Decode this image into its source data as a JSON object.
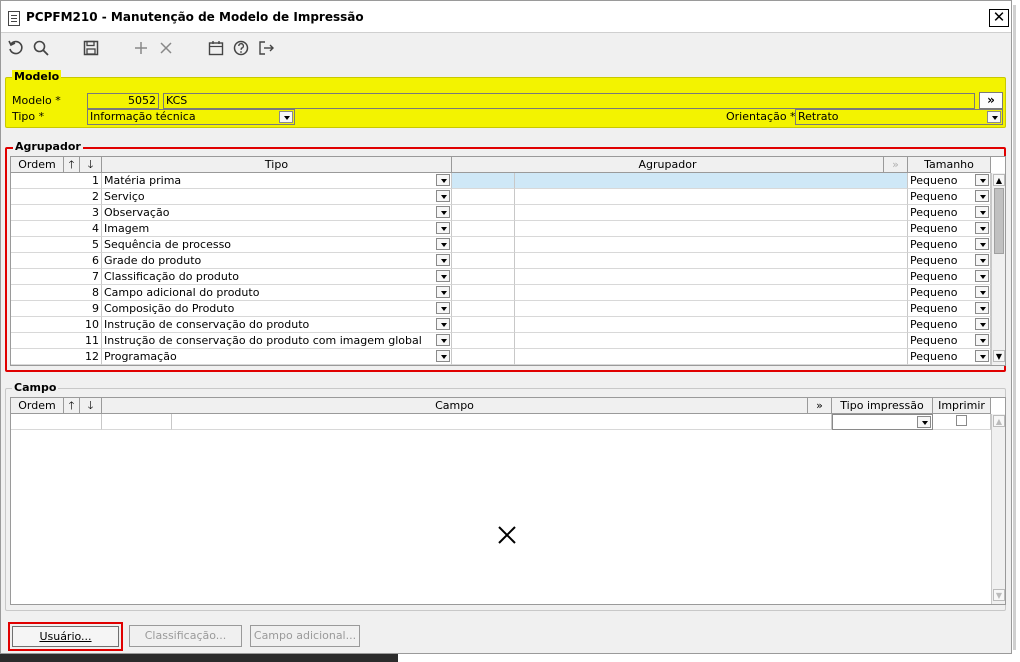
{
  "window": {
    "title": "PCPFM210 - Manutenção de Modelo de Impressão",
    "close_label": "✕"
  },
  "toolbar": {
    "icons": [
      "refresh-icon",
      "search-icon",
      "save-icon",
      "add-icon",
      "delete-icon",
      "calendar-icon",
      "help-icon",
      "exit-icon"
    ]
  },
  "modelo": {
    "group_label": "Modelo",
    "modelo_label": "Modelo *",
    "modelo_code": "5052",
    "modelo_name": "KCS",
    "lookup_label": "»",
    "tipo_label": "Tipo *",
    "tipo_value": "Informação técnica",
    "orientacao_label": "Orientação *",
    "orientacao_value": "Retrato"
  },
  "agrupador": {
    "group_label": "Agrupador",
    "headers": {
      "ordem": "Ordem",
      "up": "🡑",
      "down": "🡓",
      "tipo": "Tipo",
      "agrupador": "Agrupador",
      "expand": "»",
      "tamanho": "Tamanho"
    },
    "rows": [
      {
        "ordem": "1",
        "tipo": "Matéria prima",
        "tamanho": "Pequeno"
      },
      {
        "ordem": "2",
        "tipo": "Serviço",
        "tamanho": "Pequeno"
      },
      {
        "ordem": "3",
        "tipo": "Observação",
        "tamanho": "Pequeno"
      },
      {
        "ordem": "4",
        "tipo": "Imagem",
        "tamanho": "Pequeno"
      },
      {
        "ordem": "5",
        "tipo": "Sequência de processo",
        "tamanho": "Pequeno"
      },
      {
        "ordem": "6",
        "tipo": "Grade do produto",
        "tamanho": "Pequeno"
      },
      {
        "ordem": "7",
        "tipo": "Classificação do produto",
        "tamanho": "Pequeno"
      },
      {
        "ordem": "8",
        "tipo": "Campo adicional do produto",
        "tamanho": "Pequeno"
      },
      {
        "ordem": "9",
        "tipo": "Composição do Produto",
        "tamanho": "Pequeno"
      },
      {
        "ordem": "10",
        "tipo": "Instrução de conservação do produto",
        "tamanho": "Pequeno"
      },
      {
        "ordem": "11",
        "tipo": "Instrução de conservação do produto com imagem global",
        "tamanho": "Pequeno"
      },
      {
        "ordem": "12",
        "tipo": "Programação",
        "tamanho": "Pequeno"
      }
    ]
  },
  "campo": {
    "group_label": "Campo",
    "headers": {
      "ordem": "Ordem",
      "up": "🡑",
      "down": "🡓",
      "campo": "Campo",
      "expand": "»",
      "tipo_impressao": "Tipo impressão",
      "imprimir": "Imprimir"
    }
  },
  "buttons": {
    "usuario": "Usuário...",
    "classificacao": "Classificação...",
    "campo_adicional": "Campo adicional..."
  }
}
